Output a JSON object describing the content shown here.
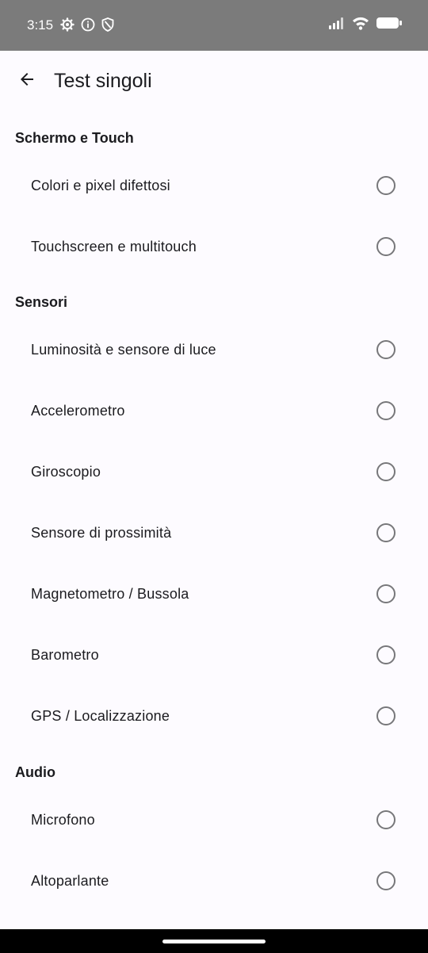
{
  "status_bar": {
    "time": "3:15",
    "left_icons": [
      "settings-icon",
      "info-icon",
      "shield-icon"
    ],
    "right_icons": [
      "signal-icon",
      "wifi-icon",
      "battery-icon"
    ]
  },
  "app_bar": {
    "title": "Test singoli"
  },
  "sections": [
    {
      "header": "Schermo e Touch",
      "items": [
        {
          "label": "Colori e pixel difettosi",
          "checked": false
        },
        {
          "label": "Touchscreen e multitouch",
          "checked": false
        }
      ]
    },
    {
      "header": "Sensori",
      "items": [
        {
          "label": "Luminosità e sensore di luce",
          "checked": false
        },
        {
          "label": "Accelerometro",
          "checked": false
        },
        {
          "label": "Giroscopio",
          "checked": false
        },
        {
          "label": "Sensore di prossimità",
          "checked": false
        },
        {
          "label": "Magnetometro / Bussola",
          "checked": false
        },
        {
          "label": "Barometro",
          "checked": false
        },
        {
          "label": "GPS / Localizzazione",
          "checked": false
        }
      ]
    },
    {
      "header": "Audio",
      "items": [
        {
          "label": "Microfono",
          "checked": false
        },
        {
          "label": "Altoparlante",
          "checked": false
        }
      ]
    }
  ]
}
